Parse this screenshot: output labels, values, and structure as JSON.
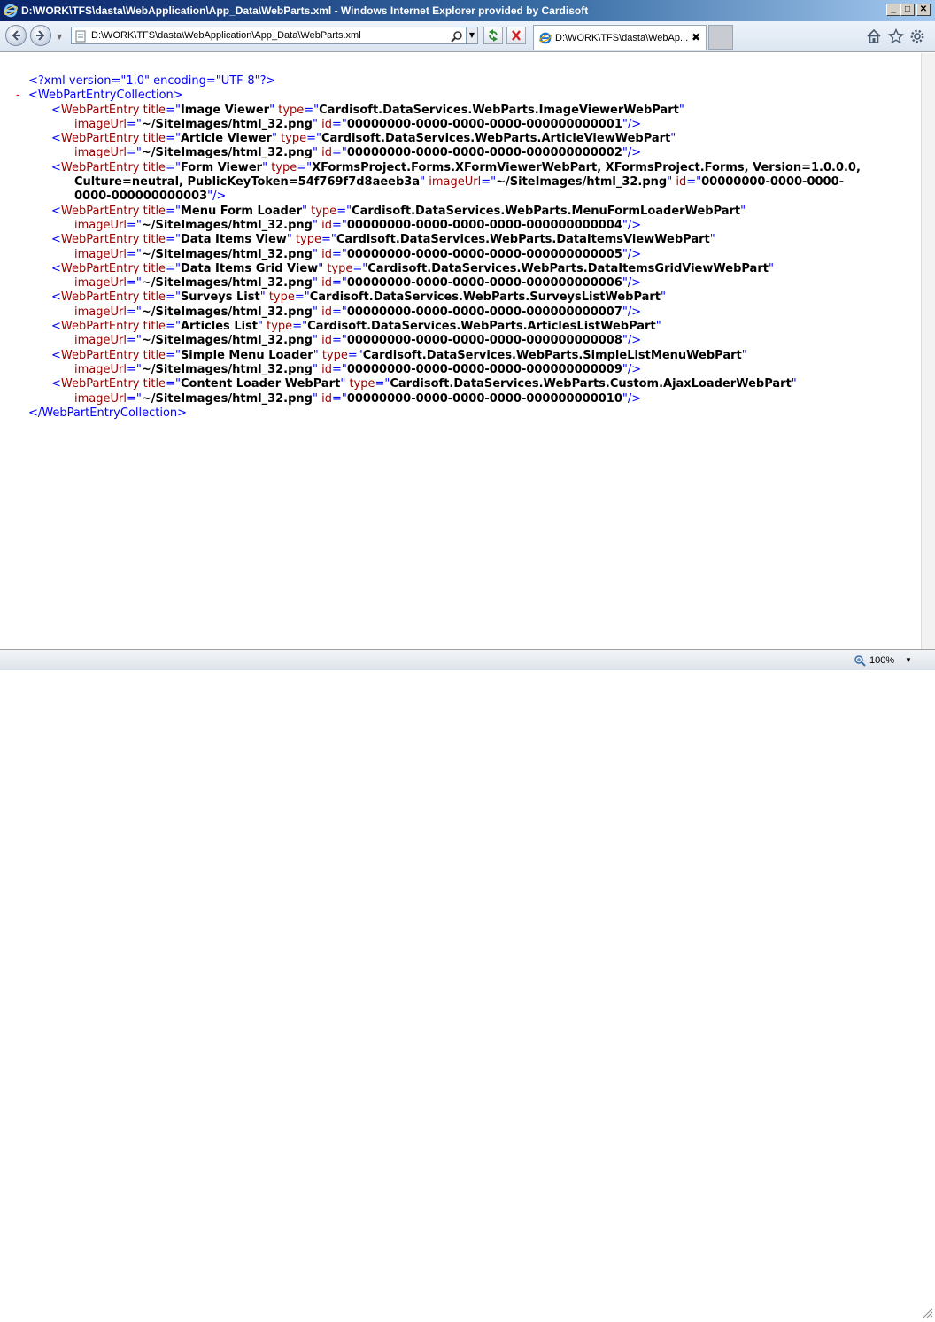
{
  "window": {
    "title": "D:\\WORK\\TFS\\dasta\\WebApplication\\App_Data\\WebParts.xml - Windows Internet Explorer provided by Cardisoft",
    "minimize_label": "_",
    "maximize_label": "□",
    "close_label": "✕"
  },
  "toolbar": {
    "address": "D:\\WORK\\TFS\\dasta\\WebApplication\\App_Data\\WebParts.xml",
    "tab_title": "D:\\WORK\\TFS\\dasta\\WebAp...",
    "tab_close": "✖"
  },
  "xml": {
    "declaration": "<?xml version=\"1.0\" encoding=\"UTF-8\"?>",
    "collapse_marker": "-",
    "root_open": "<WebPartEntryCollection>",
    "root_close": "</WebPartEntryCollection>",
    "entries": [
      {
        "title": "Image Viewer",
        "type": "Cardisoft.DataServices.WebParts.ImageViewerWebPart",
        "imageUrl": "~/SiteImages/html_32.png",
        "id": "00000000-0000-0000-0000-000000000001"
      },
      {
        "title": "Article Viewer",
        "type": "Cardisoft.DataServices.WebParts.ArticleViewWebPart",
        "imageUrl": "~/SiteImages/html_32.png",
        "id": "00000000-0000-0000-0000-000000000002"
      },
      {
        "title": "Form Viewer",
        "type_line1": "XFormsProject.Forms.XFormViewerWebPart, XFormsProject.Forms, Version=1.0.0.0,",
        "type_line2": "Culture=neutral, PublicKeyToken=54f769f7d8aeeb3a",
        "imageUrl": "~/SiteImages/html_32.png",
        "id_part1": "00000000-0000-0000-",
        "id_part2": "0000-000000000003"
      },
      {
        "title": "Menu Form Loader",
        "type": "Cardisoft.DataServices.WebParts.MenuFormLoaderWebPart",
        "imageUrl": "~/SiteImages/html_32.png",
        "id": "00000000-0000-0000-0000-000000000004"
      },
      {
        "title": "Data Items View",
        "type": "Cardisoft.DataServices.WebParts.DataItemsViewWebPart",
        "imageUrl": "~/SiteImages/html_32.png",
        "id": "00000000-0000-0000-0000-000000000005"
      },
      {
        "title": "Data Items Grid View",
        "type": "Cardisoft.DataServices.WebParts.DataItemsGridViewWebPart",
        "imageUrl": "~/SiteImages/html_32.png",
        "id": "00000000-0000-0000-0000-000000000006"
      },
      {
        "title": "Surveys List",
        "type": "Cardisoft.DataServices.WebParts.SurveysListWebPart",
        "imageUrl": "~/SiteImages/html_32.png",
        "id": "00000000-0000-0000-0000-000000000007"
      },
      {
        "title": "Articles List",
        "type": "Cardisoft.DataServices.WebParts.ArticlesListWebPart",
        "imageUrl": "~/SiteImages/html_32.png",
        "id": "00000000-0000-0000-0000-000000000008"
      },
      {
        "title": "Simple Menu Loader",
        "type": "Cardisoft.DataServices.WebParts.SimpleListMenuWebPart",
        "imageUrl": "~/SiteImages/html_32.png",
        "id": "00000000-0000-0000-0000-000000000009"
      },
      {
        "title": "Content Loader WebPart",
        "type": "Cardisoft.DataServices.WebParts.Custom.AjaxLoaderWebPart",
        "imageUrl": "~/SiteImages/html_32.png",
        "id": "00000000-0000-0000-0000-000000000010"
      }
    ]
  },
  "status": {
    "zoom": "100%"
  },
  "icons": {
    "browser": "ie-logo-icon",
    "back": "back-arrow-icon",
    "forward": "forward-arrow-icon",
    "search": "search-icon",
    "refresh": "refresh-icon",
    "stop": "stop-icon",
    "home": "home-icon",
    "favorites": "star-icon",
    "tools": "gear-icon",
    "zoom": "zoom-icon"
  },
  "colors": {
    "tag": "#990000",
    "markup": "#0000ff",
    "value": "#000000",
    "collapse": "#ff0000"
  }
}
